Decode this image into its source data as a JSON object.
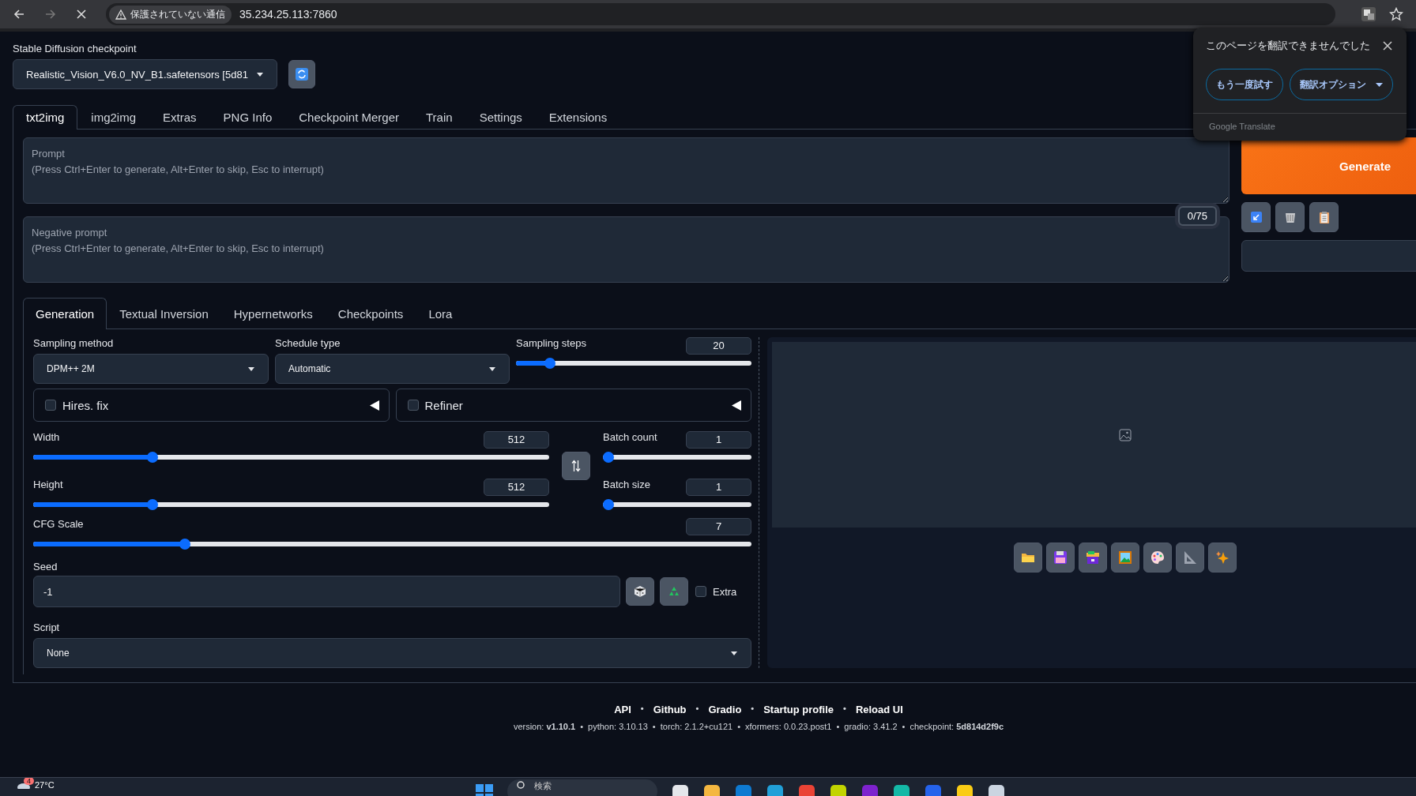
{
  "browser": {
    "security_label": "保護されていない通信",
    "url": "35.234.25.113:7860"
  },
  "checkpoint": {
    "label": "Stable Diffusion checkpoint",
    "value": "Realistic_Vision_V6.0_NV_B1.safetensors [5d81"
  },
  "tabs": [
    {
      "label": "txt2img",
      "selected": true
    },
    {
      "label": "img2img",
      "selected": false
    },
    {
      "label": "Extras",
      "selected": false
    },
    {
      "label": "PNG Info",
      "selected": false
    },
    {
      "label": "Checkpoint Merger",
      "selected": false
    },
    {
      "label": "Train",
      "selected": false
    },
    {
      "label": "Settings",
      "selected": false
    },
    {
      "label": "Extensions",
      "selected": false
    }
  ],
  "prompt": {
    "placeholder": "Prompt\n(Press Ctrl+Enter to generate, Alt+Enter to skip, Esc to interrupt)"
  },
  "negative_prompt": {
    "placeholder": "Negative prompt\n(Press Ctrl+Enter to generate, Alt+Enter to skip, Esc to interrupt)",
    "token_count": "0/75"
  },
  "generate_button": "Generate",
  "sub_tabs": [
    {
      "label": "Generation",
      "selected": true
    },
    {
      "label": "Textual Inversion",
      "selected": false
    },
    {
      "label": "Hypernetworks",
      "selected": false
    },
    {
      "label": "Checkpoints",
      "selected": false
    },
    {
      "label": "Lora",
      "selected": false
    }
  ],
  "sampling_method": {
    "label": "Sampling method",
    "value": "DPM++ 2M"
  },
  "schedule_type": {
    "label": "Schedule type",
    "value": "Automatic"
  },
  "sampling_steps": {
    "label": "Sampling steps",
    "value": "20",
    "level": 0.128
  },
  "accordions": [
    {
      "label": "Hires. fix",
      "checked": false
    },
    {
      "label": "Refiner",
      "checked": false
    }
  ],
  "width": {
    "label": "Width",
    "value": "512",
    "level": 0.226
  },
  "height": {
    "label": "Height",
    "value": "512",
    "level": 0.226
  },
  "batch_count": {
    "label": "Batch count",
    "value": "1",
    "level": 0
  },
  "batch_size": {
    "label": "Batch size",
    "value": "1",
    "level": 0
  },
  "cfg_scale": {
    "label": "CFG Scale",
    "value": "7",
    "level": 0.207
  },
  "seed": {
    "label": "Seed",
    "value": "-1",
    "extra": {
      "label": "Extra",
      "checked": false
    }
  },
  "script": {
    "label": "Script",
    "value": "None"
  },
  "footer": {
    "links": [
      "API",
      "Github",
      "Gradio",
      "Startup profile",
      "Reload UI"
    ],
    "versions": [
      "version: **v1.10.1**",
      "python: 3.10.13",
      "torch: 2.1.2+cu121",
      "xformers: 0.0.23.post1",
      "gradio: 3.41.2",
      "checkpoint: **5d814d2f9c**"
    ],
    "separator": "•"
  },
  "translate_popup": {
    "title": "このページを翻訳できませんでした",
    "buttons": [
      "もう一度試す",
      "翻訳オプション"
    ],
    "footer": "Google Translate"
  },
  "taskbar": {
    "weather_badge": "4",
    "temperature": "27°C",
    "search_placeholder": "検索"
  }
}
